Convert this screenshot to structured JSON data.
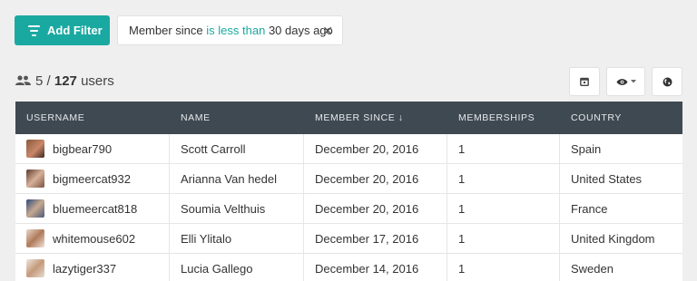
{
  "filter_bar": {
    "add_filter_label": "Add Filter",
    "chip": {
      "field": "Member since",
      "operator": "is less than",
      "value": "30 days ago",
      "close_glyph": "✕"
    }
  },
  "summary": {
    "shown": "5",
    "separator": " / ",
    "total": "127",
    "unit": "users"
  },
  "toolbar": {
    "icons": [
      "calendar-icon",
      "eye-icon",
      "globe-icon"
    ]
  },
  "table": {
    "columns": [
      "USERNAME",
      "NAME",
      "MEMBER SINCE ↓",
      "MEMBERSHIPS",
      "COUNTRY"
    ],
    "rows": [
      {
        "username": "bigbear790",
        "name": "Scott Carroll",
        "member_since": "December 20, 2016",
        "memberships": "1",
        "country": "Spain"
      },
      {
        "username": "bigmeercat932",
        "name": "Arianna Van hedel",
        "member_since": "December 20, 2016",
        "memberships": "1",
        "country": "United States"
      },
      {
        "username": "bluemeercat818",
        "name": "Soumia Velthuis",
        "member_since": "December 20, 2016",
        "memberships": "1",
        "country": "France"
      },
      {
        "username": "whitemouse602",
        "name": "Elli Ylitalo",
        "member_since": "December 17, 2016",
        "memberships": "1",
        "country": "United Kingdom"
      },
      {
        "username": "lazytiger337",
        "name": "Lucia Gallego",
        "member_since": "December 14, 2016",
        "memberships": "1",
        "country": "Sweden"
      }
    ]
  },
  "colors": {
    "accent": "#1aa9a1",
    "header_bg": "#3f4952",
    "page_bg": "#efefef"
  }
}
